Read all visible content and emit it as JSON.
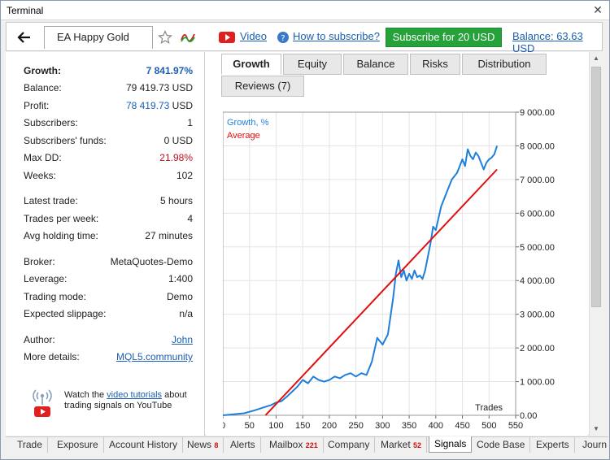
{
  "window": {
    "title": "Terminal",
    "close_glyph": "✕"
  },
  "toolbar": {
    "back_glyph": "🡐",
    "signal_name": "EA Happy Gold",
    "video_label": "Video",
    "howto_label": "How to subscribe?",
    "subscribe_label": "Subscribe for 20 USD",
    "balance_label": "Balance: 63.63 USD"
  },
  "stats": {
    "group1": [
      {
        "label": "Growth:",
        "value": "7 841.97%"
      },
      {
        "label": "Balance:",
        "value": "79 419.73 USD"
      },
      {
        "label": "Profit:",
        "value": "78 419.73 USD"
      },
      {
        "label": "Subscribers:",
        "value": "1"
      },
      {
        "label": "Subscribers' funds:",
        "value": "0 USD"
      },
      {
        "label": "Max DD:",
        "value": "21.98%"
      },
      {
        "label": "Weeks:",
        "value": "102"
      }
    ],
    "group2": [
      {
        "label": "Latest trade:",
        "value": "5 hours"
      },
      {
        "label": "Trades per week:",
        "value": "4"
      },
      {
        "label": "Avg holding time:",
        "value": "27 minutes"
      }
    ],
    "group3": [
      {
        "label": "Broker:",
        "value": "MetaQuotes-Demo"
      },
      {
        "label": "Leverage:",
        "value": "1:400"
      },
      {
        "label": "Trading mode:",
        "value": "Demo"
      },
      {
        "label": "Expected slippage:",
        "value": "n/a"
      }
    ],
    "group4": [
      {
        "label": "Author:",
        "value": "John"
      },
      {
        "label": "More details:",
        "value": "MQL5.community"
      }
    ]
  },
  "tutorial": {
    "prefix": "Watch the ",
    "link": "video tutorials",
    "suffix": " about trading signals on YouTube"
  },
  "tabs": [
    "Growth",
    "Equity",
    "Balance",
    "Risks",
    "Distribution",
    "Reviews (7)"
  ],
  "bottom_tabs": [
    {
      "label": "Trade",
      "count": ""
    },
    {
      "label": "Exposure",
      "count": ""
    },
    {
      "label": "Account History",
      "count": ""
    },
    {
      "label": "News",
      "count": "8"
    },
    {
      "label": "Alerts",
      "count": ""
    },
    {
      "label": "Mailbox",
      "count": "221"
    },
    {
      "label": "Company",
      "count": ""
    },
    {
      "label": "Market",
      "count": "52"
    },
    {
      "label": "Signals",
      "count": ""
    },
    {
      "label": "Code Base",
      "count": ""
    },
    {
      "label": "Experts",
      "count": ""
    },
    {
      "label": "Journ",
      "count": ""
    }
  ],
  "colors": {
    "growth": "#1e7fdc",
    "average": "#e01010",
    "accent_green": "#25a33a"
  },
  "chart_data": {
    "type": "line",
    "xlabel": "Trades",
    "ylabel": "",
    "x_ticks": [
      "0",
      "50",
      "100",
      "150",
      "200",
      "250",
      "300",
      "350",
      "400",
      "450",
      "500",
      "550"
    ],
    "y_ticks": [
      "0.00",
      "1 000.00",
      "2 000.00",
      "3 000.00",
      "4 000.00",
      "5 000.00",
      "6 000.00",
      "7 000.00",
      "8 000.00",
      "9 000.00"
    ],
    "xlim": [
      0,
      550
    ],
    "ylim": [
      0,
      9000
    ],
    "grid": true,
    "legend_position": "top-left",
    "series": [
      {
        "name": "Growth, %",
        "color": "#1e7fdc",
        "x": [
          0,
          20,
          40,
          60,
          70,
          80,
          90,
          100,
          110,
          120,
          130,
          140,
          150,
          160,
          170,
          180,
          190,
          200,
          210,
          220,
          230,
          240,
          250,
          260,
          270,
          280,
          290,
          300,
          310,
          320,
          325,
          330,
          335,
          340,
          345,
          350,
          355,
          360,
          365,
          370,
          375,
          380,
          385,
          390,
          395,
          400,
          410,
          420,
          430,
          440,
          450,
          455,
          460,
          465,
          470,
          475,
          480,
          485,
          490,
          495,
          500,
          505,
          510,
          515
        ],
        "y": [
          0,
          30,
          60,
          150,
          200,
          250,
          300,
          380,
          420,
          550,
          700,
          850,
          1050,
          950,
          1150,
          1050,
          1000,
          1050,
          1150,
          1100,
          1200,
          1250,
          1150,
          1250,
          1200,
          1600,
          2300,
          2100,
          2400,
          3500,
          4200,
          4600,
          4100,
          4300,
          4000,
          4200,
          4050,
          4300,
          4100,
          4150,
          4050,
          4300,
          4700,
          5100,
          5600,
          5500,
          6200,
          6600,
          7000,
          7200,
          7600,
          7400,
          7900,
          7700,
          7600,
          7800,
          7700,
          7500,
          7300,
          7500,
          7600,
          7650,
          7750,
          8000
        ]
      },
      {
        "name": "Average",
        "color": "#e01010",
        "x": [
          80,
          515
        ],
        "y": [
          0,
          7300
        ]
      }
    ]
  }
}
